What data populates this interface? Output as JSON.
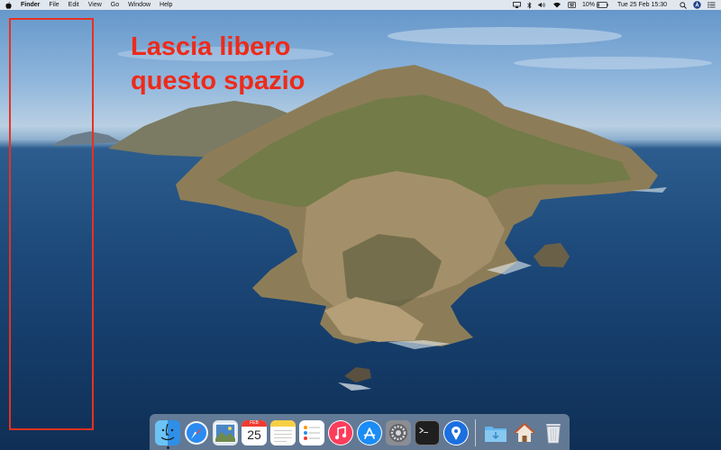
{
  "menubar": {
    "app_name": "Finder",
    "menus": [
      "File",
      "Edit",
      "View",
      "Go",
      "Window",
      "Help"
    ],
    "battery": "10%",
    "clock": "Tue 25 Feb  15:30"
  },
  "annotation": {
    "line1": "Lascia libero",
    "line2": "questo spazio",
    "color": "#ee2a1a"
  },
  "dock": {
    "items": [
      {
        "name": "finder-icon",
        "running": true
      },
      {
        "name": "safari-icon",
        "running": false
      },
      {
        "name": "photo-preview-icon",
        "running": false
      },
      {
        "name": "calendar-icon",
        "running": false,
        "month": "FEB",
        "day": "25"
      },
      {
        "name": "notes-icon",
        "running": false
      },
      {
        "name": "reminders-icon",
        "running": false
      },
      {
        "name": "music-icon",
        "running": false
      },
      {
        "name": "app-store-icon",
        "running": false
      },
      {
        "name": "system-preferences-icon",
        "running": false
      },
      {
        "name": "terminal-icon",
        "running": false
      },
      {
        "name": "maps-pin-icon",
        "running": false
      },
      {
        "name": "downloads-folder-icon",
        "running": false
      },
      {
        "name": "home-icon",
        "running": false
      },
      {
        "name": "trash-icon",
        "running": false
      }
    ]
  }
}
